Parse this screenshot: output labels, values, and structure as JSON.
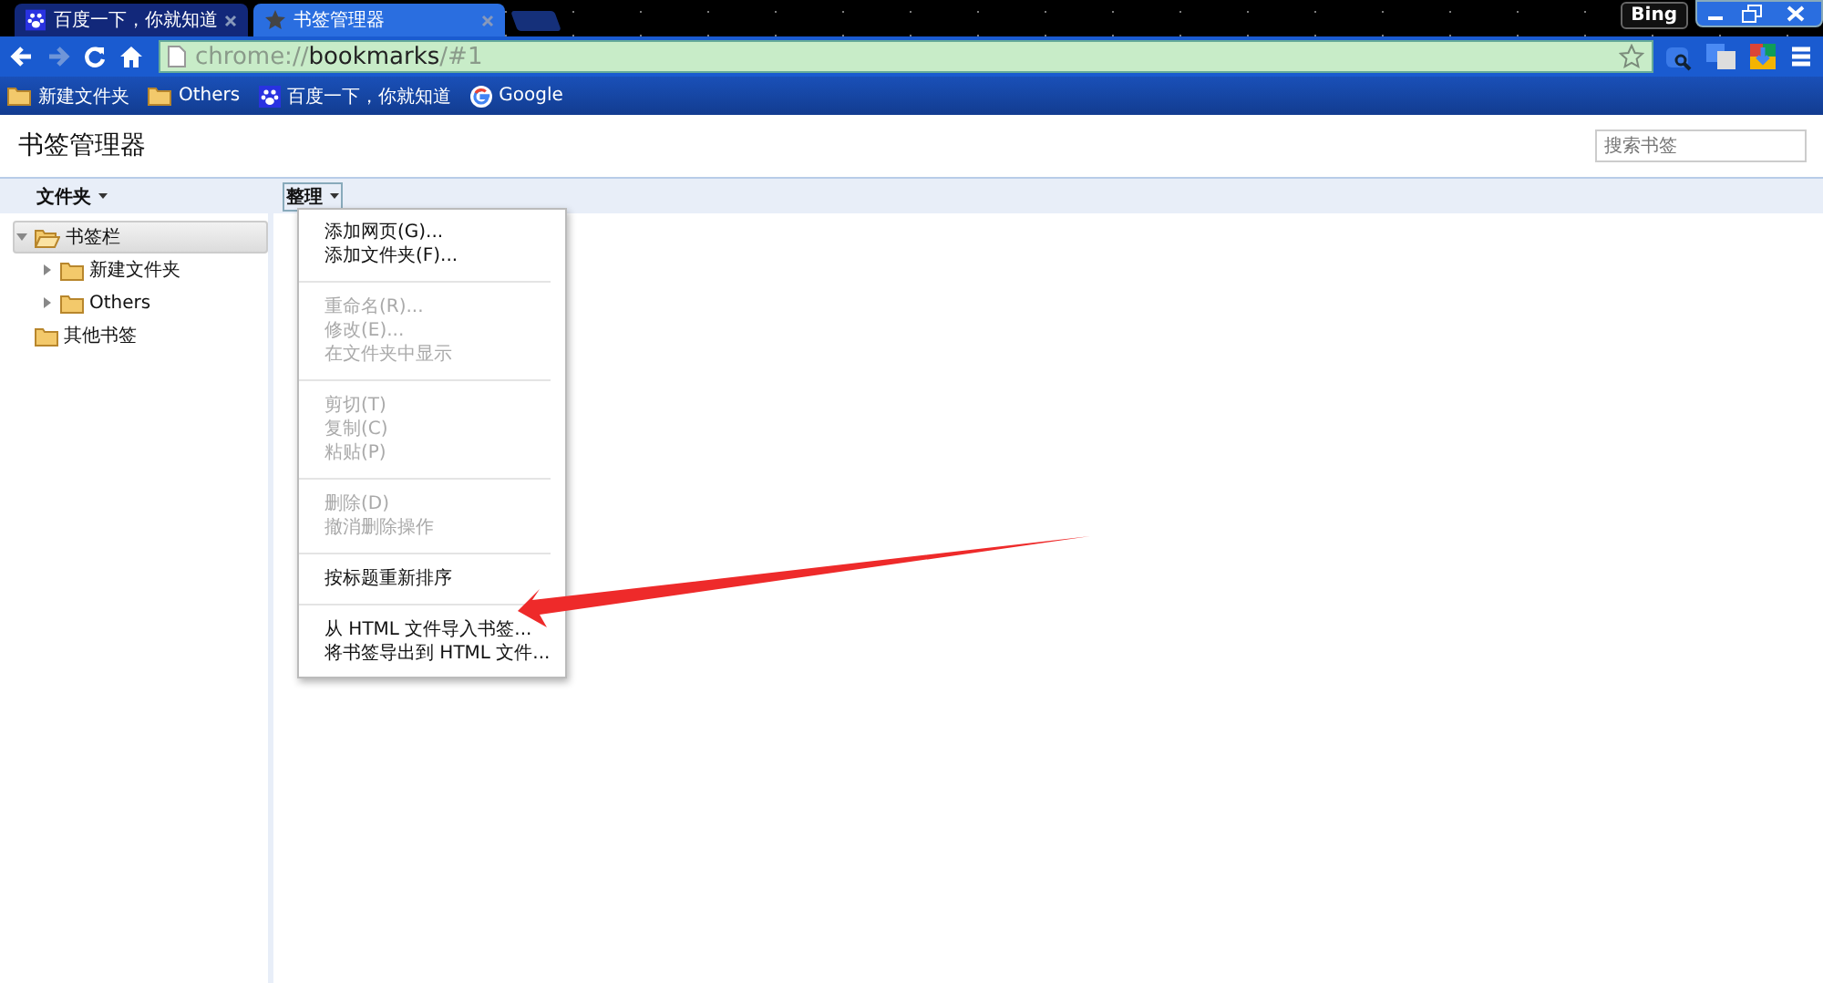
{
  "tabs": [
    {
      "title": "百度一下，你就知道",
      "kind": "baidu",
      "selected": false
    },
    {
      "title": "书签管理器",
      "kind": "star",
      "selected": true
    }
  ],
  "profile": "Bing",
  "omnibox": {
    "scheme": "chrome://",
    "host": "bookmarks",
    "path": "/#1"
  },
  "bookmarks_bar": [
    {
      "label": "新建文件夹",
      "kind": "folder"
    },
    {
      "label": "Others",
      "kind": "folder"
    },
    {
      "label": "百度一下，你就知道",
      "kind": "baidu"
    },
    {
      "label": "Google",
      "kind": "google"
    }
  ],
  "page_title": "书签管理器",
  "search": {
    "placeholder": "搜索书签"
  },
  "folders_menu": "文件夹",
  "organize_menu": "整理",
  "tree": [
    {
      "label": "书签栏",
      "selected": true,
      "expanded": true,
      "children": [
        {
          "label": "新建文件夹",
          "selected": false,
          "expanded": false
        },
        {
          "label": "Others",
          "selected": false,
          "expanded": false
        }
      ]
    },
    {
      "label": "其他书签",
      "selected": false
    }
  ],
  "menu_groups": [
    [
      {
        "label": "添加网页(G)...",
        "disabled": false
      },
      {
        "label": "添加文件夹(F)...",
        "disabled": false
      }
    ],
    [
      {
        "label": "重命名(R)...",
        "disabled": true
      },
      {
        "label": "修改(E)...",
        "disabled": true
      },
      {
        "label": "在文件夹中显示",
        "disabled": true
      }
    ],
    [
      {
        "label": "剪切(T)",
        "disabled": true
      },
      {
        "label": "复制(C)",
        "disabled": true
      },
      {
        "label": "粘贴(P)",
        "disabled": true
      }
    ],
    [
      {
        "label": "删除(D)",
        "disabled": true
      },
      {
        "label": "撤消删除操作",
        "disabled": true
      }
    ],
    [
      {
        "label": "按标题重新排序",
        "disabled": false
      }
    ],
    [
      {
        "label": "从 HTML 文件导入书签...",
        "disabled": false
      },
      {
        "label": "将书签导出到 HTML 文件...",
        "disabled": false
      }
    ]
  ]
}
